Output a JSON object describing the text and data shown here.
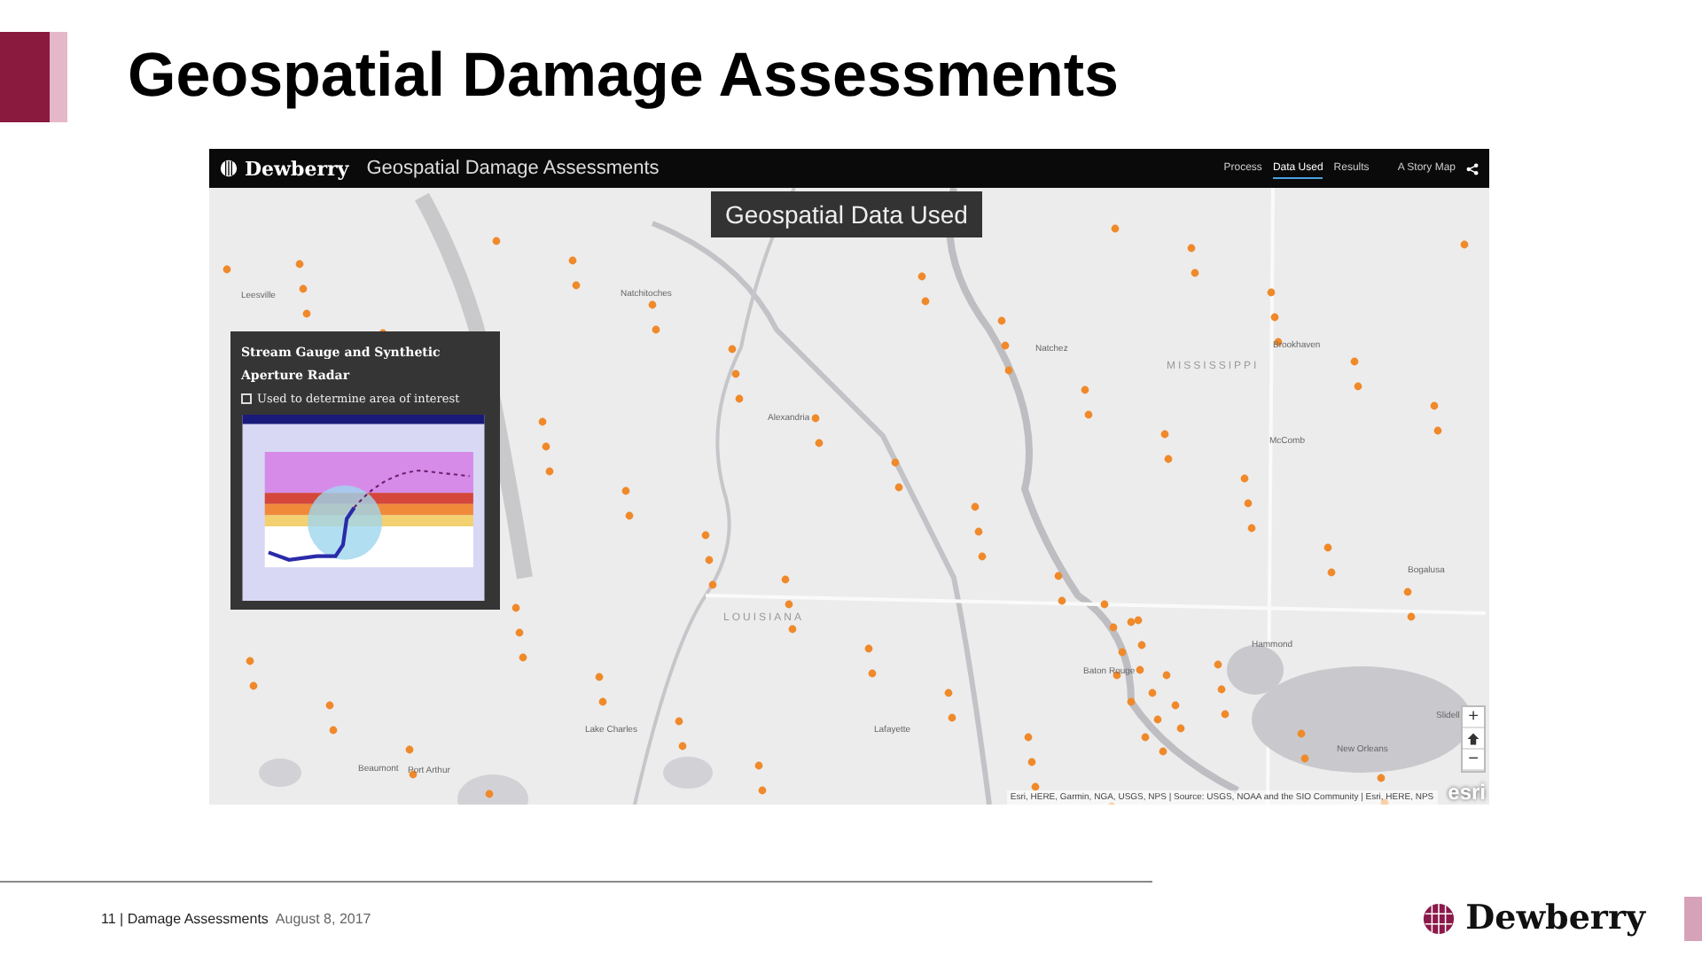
{
  "slide": {
    "title": "Geospatial Damage Assessments"
  },
  "app": {
    "brand": "Dewberry",
    "title": "Geospatial Damage Assessments",
    "nav": [
      {
        "label": "Process",
        "selected": false
      },
      {
        "label": "Data Used",
        "selected": true
      },
      {
        "label": "Results",
        "selected": false
      }
    ],
    "story_map_label": "A Story Map"
  },
  "banner": "Geospatial Data Used",
  "info_panel": {
    "heading": "Stream Gauge and Synthetic Aperture Radar",
    "bullet": "Used to determine area of interest"
  },
  "map_labels": [
    {
      "text": "Natchitoches",
      "kind": "city"
    },
    {
      "text": "Leesville",
      "kind": "city"
    },
    {
      "text": "Alexandria",
      "kind": "city"
    },
    {
      "text": "Natchez",
      "kind": "city"
    },
    {
      "text": "Brookhaven",
      "kind": "city"
    },
    {
      "text": "MISSISSIPPI",
      "kind": "state"
    },
    {
      "text": "McComb",
      "kind": "city"
    },
    {
      "text": "LOUISIANA",
      "kind": "state"
    },
    {
      "text": "Bogalusa",
      "kind": "city"
    },
    {
      "text": "Baton Rouge",
      "kind": "city"
    },
    {
      "text": "Hammond",
      "kind": "city"
    },
    {
      "text": "Slidell",
      "kind": "city"
    },
    {
      "text": "Lake Charles",
      "kind": "city"
    },
    {
      "text": "Lafayette",
      "kind": "city"
    },
    {
      "text": "Beaumont",
      "kind": "city"
    },
    {
      "text": "Port Arthur",
      "kind": "city"
    },
    {
      "text": "New Orleans",
      "kind": "city"
    }
  ],
  "zoom_in": "+",
  "zoom_out": "−",
  "attribution": "Esri, HERE, Garmin, NGA, USGS, NPS | Source: USGS, NOAA and the SIO Community | Esri, HERE, NPS",
  "esri_logo": "esri",
  "footer": {
    "page": "11",
    "separator": "|",
    "section": "Damage Assessments",
    "date": "August 8, 2017",
    "logo": "Dewberry"
  }
}
